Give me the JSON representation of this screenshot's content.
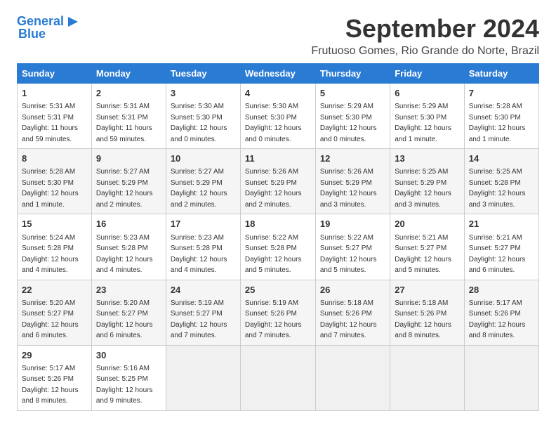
{
  "logo": {
    "line1": "General",
    "line2": "Blue",
    "arrow": "▶"
  },
  "title": "September 2024",
  "location": "Frutuoso Gomes, Rio Grande do Norte, Brazil",
  "weekdays": [
    "Sunday",
    "Monday",
    "Tuesday",
    "Wednesday",
    "Thursday",
    "Friday",
    "Saturday"
  ],
  "weeks": [
    [
      {
        "day": "1",
        "info": "Sunrise: 5:31 AM\nSunset: 5:31 PM\nDaylight: 11 hours\nand 59 minutes."
      },
      {
        "day": "2",
        "info": "Sunrise: 5:31 AM\nSunset: 5:31 PM\nDaylight: 11 hours\nand 59 minutes."
      },
      {
        "day": "3",
        "info": "Sunrise: 5:30 AM\nSunset: 5:30 PM\nDaylight: 12 hours\nand 0 minutes."
      },
      {
        "day": "4",
        "info": "Sunrise: 5:30 AM\nSunset: 5:30 PM\nDaylight: 12 hours\nand 0 minutes."
      },
      {
        "day": "5",
        "info": "Sunrise: 5:29 AM\nSunset: 5:30 PM\nDaylight: 12 hours\nand 0 minutes."
      },
      {
        "day": "6",
        "info": "Sunrise: 5:29 AM\nSunset: 5:30 PM\nDaylight: 12 hours\nand 1 minute."
      },
      {
        "day": "7",
        "info": "Sunrise: 5:28 AM\nSunset: 5:30 PM\nDaylight: 12 hours\nand 1 minute."
      }
    ],
    [
      {
        "day": "8",
        "info": "Sunrise: 5:28 AM\nSunset: 5:30 PM\nDaylight: 12 hours\nand 1 minute."
      },
      {
        "day": "9",
        "info": "Sunrise: 5:27 AM\nSunset: 5:29 PM\nDaylight: 12 hours\nand 2 minutes."
      },
      {
        "day": "10",
        "info": "Sunrise: 5:27 AM\nSunset: 5:29 PM\nDaylight: 12 hours\nand 2 minutes."
      },
      {
        "day": "11",
        "info": "Sunrise: 5:26 AM\nSunset: 5:29 PM\nDaylight: 12 hours\nand 2 minutes."
      },
      {
        "day": "12",
        "info": "Sunrise: 5:26 AM\nSunset: 5:29 PM\nDaylight: 12 hours\nand 3 minutes."
      },
      {
        "day": "13",
        "info": "Sunrise: 5:25 AM\nSunset: 5:29 PM\nDaylight: 12 hours\nand 3 minutes."
      },
      {
        "day": "14",
        "info": "Sunrise: 5:25 AM\nSunset: 5:28 PM\nDaylight: 12 hours\nand 3 minutes."
      }
    ],
    [
      {
        "day": "15",
        "info": "Sunrise: 5:24 AM\nSunset: 5:28 PM\nDaylight: 12 hours\nand 4 minutes."
      },
      {
        "day": "16",
        "info": "Sunrise: 5:23 AM\nSunset: 5:28 PM\nDaylight: 12 hours\nand 4 minutes."
      },
      {
        "day": "17",
        "info": "Sunrise: 5:23 AM\nSunset: 5:28 PM\nDaylight: 12 hours\nand 4 minutes."
      },
      {
        "day": "18",
        "info": "Sunrise: 5:22 AM\nSunset: 5:28 PM\nDaylight: 12 hours\nand 5 minutes."
      },
      {
        "day": "19",
        "info": "Sunrise: 5:22 AM\nSunset: 5:27 PM\nDaylight: 12 hours\nand 5 minutes."
      },
      {
        "day": "20",
        "info": "Sunrise: 5:21 AM\nSunset: 5:27 PM\nDaylight: 12 hours\nand 5 minutes."
      },
      {
        "day": "21",
        "info": "Sunrise: 5:21 AM\nSunset: 5:27 PM\nDaylight: 12 hours\nand 6 minutes."
      }
    ],
    [
      {
        "day": "22",
        "info": "Sunrise: 5:20 AM\nSunset: 5:27 PM\nDaylight: 12 hours\nand 6 minutes."
      },
      {
        "day": "23",
        "info": "Sunrise: 5:20 AM\nSunset: 5:27 PM\nDaylight: 12 hours\nand 6 minutes."
      },
      {
        "day": "24",
        "info": "Sunrise: 5:19 AM\nSunset: 5:27 PM\nDaylight: 12 hours\nand 7 minutes."
      },
      {
        "day": "25",
        "info": "Sunrise: 5:19 AM\nSunset: 5:26 PM\nDaylight: 12 hours\nand 7 minutes."
      },
      {
        "day": "26",
        "info": "Sunrise: 5:18 AM\nSunset: 5:26 PM\nDaylight: 12 hours\nand 7 minutes."
      },
      {
        "day": "27",
        "info": "Sunrise: 5:18 AM\nSunset: 5:26 PM\nDaylight: 12 hours\nand 8 minutes."
      },
      {
        "day": "28",
        "info": "Sunrise: 5:17 AM\nSunset: 5:26 PM\nDaylight: 12 hours\nand 8 minutes."
      }
    ],
    [
      {
        "day": "29",
        "info": "Sunrise: 5:17 AM\nSunset: 5:26 PM\nDaylight: 12 hours\nand 8 minutes."
      },
      {
        "day": "30",
        "info": "Sunrise: 5:16 AM\nSunset: 5:25 PM\nDaylight: 12 hours\nand 9 minutes."
      },
      {
        "day": "",
        "info": ""
      },
      {
        "day": "",
        "info": ""
      },
      {
        "day": "",
        "info": ""
      },
      {
        "day": "",
        "info": ""
      },
      {
        "day": "",
        "info": ""
      }
    ]
  ]
}
